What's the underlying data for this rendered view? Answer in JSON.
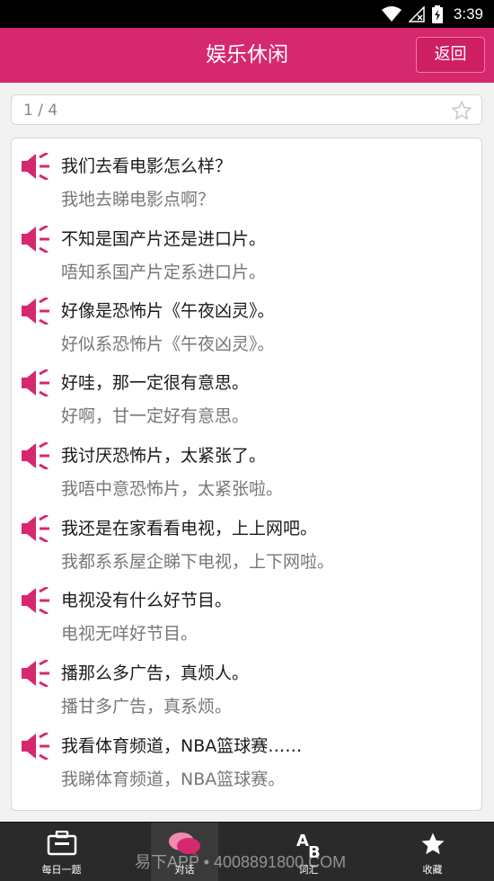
{
  "status_bar": {
    "time": "3:39",
    "icons": [
      "wifi-icon",
      "no-signal-icon",
      "battery-charging-icon"
    ]
  },
  "app_bar": {
    "title": "娱乐休闲",
    "back_label": "返回"
  },
  "pager": {
    "text": "1 / 4",
    "favorite_icon": "star-outline-icon"
  },
  "dialog": [
    {
      "mandarin": "我们去看电影怎么样？",
      "cantonese": "我地去睇电影点啊？"
    },
    {
      "mandarin": "不知是国产片还是进口片。",
      "cantonese": "唔知系国产片定系进口片。"
    },
    {
      "mandarin": "好像是恐怖片《午夜凶灵》。",
      "cantonese": "好似系恐怖片《午夜凶灵》。"
    },
    {
      "mandarin": "好哇，那一定很有意思。",
      "cantonese": "好啊，甘一定好有意思。"
    },
    {
      "mandarin": "我讨厌恐怖片，太紧张了。",
      "cantonese": "我唔中意恐怖片，太紧张啦。"
    },
    {
      "mandarin": "我还是在家看看电视，上上网吧。",
      "cantonese": "我都系系屋企睇下电视，上下网啦。"
    },
    {
      "mandarin": "电视没有什么好节目。",
      "cantonese": "电视无咩好节目。"
    },
    {
      "mandarin": "播那么多广告，真烦人。",
      "cantonese": "播甘多广告，真系烦。"
    },
    {
      "mandarin": "我看体育频道，NBA篮球赛……",
      "cantonese": "我睇体育频道，NBA篮球赛。"
    }
  ],
  "colors": {
    "accent": "#d6286f",
    "speaker": "#d6286f",
    "nav_bg": "#2a2a2a"
  },
  "bottom_nav": [
    {
      "label": "每日一题",
      "icon": "briefcase-icon",
      "active": false
    },
    {
      "label": "对话",
      "icon": "chat-bubbles-icon",
      "active": true
    },
    {
      "label": "词汇",
      "icon": "ab-letters-icon",
      "active": false
    },
    {
      "label": "收藏",
      "icon": "star-icon",
      "active": false
    }
  ],
  "watermark": "易下APP • 4008891800.COM"
}
